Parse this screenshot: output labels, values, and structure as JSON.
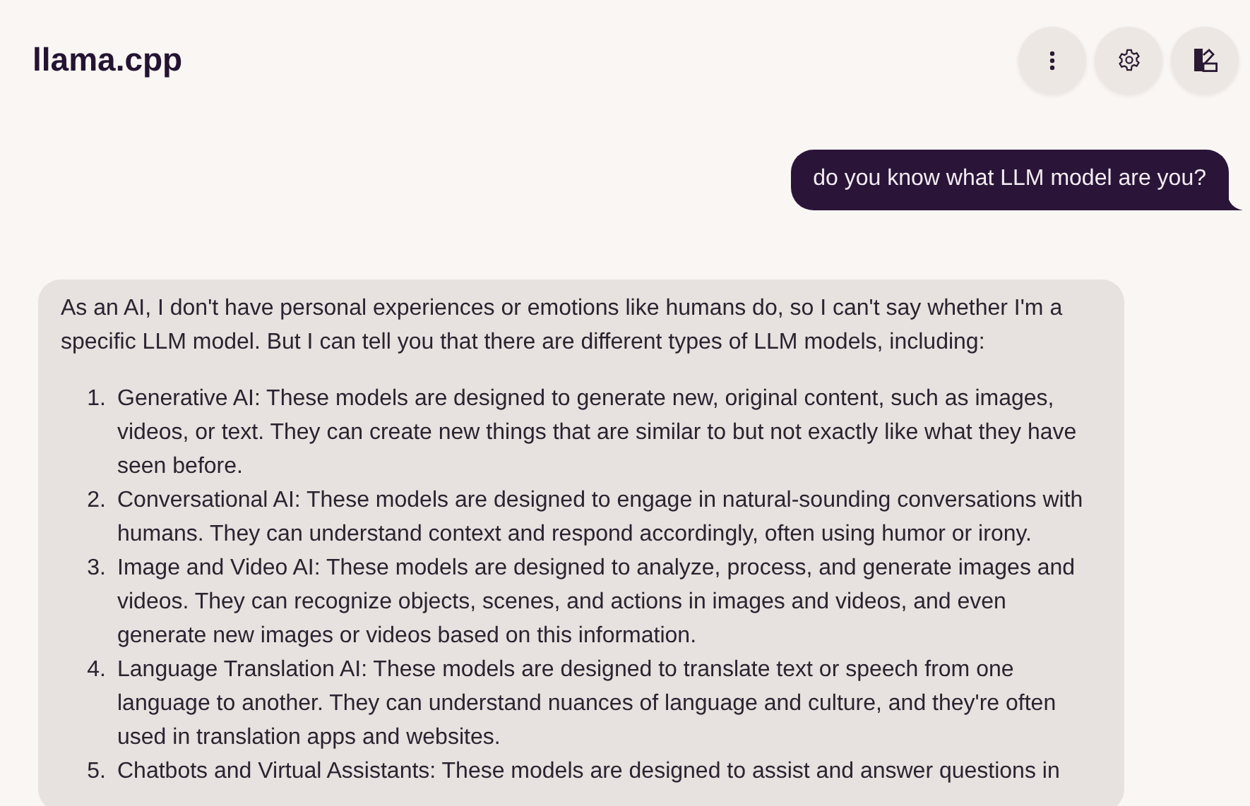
{
  "header": {
    "title": "llama.cpp",
    "buttons": [
      {
        "kind": "menu"
      },
      {
        "kind": "settings"
      },
      {
        "kind": "theme"
      }
    ]
  },
  "messages": [
    {
      "kind": "user",
      "text": "do you know what LLM model are you?"
    },
    {
      "kind": "assistant",
      "intro": "As an AI, I don't have personal experiences or emotions like humans do, so I can't say whether I'm a specific LLM model. But I can tell you that there are different types of LLM models, including:",
      "items": [
        {
          "number": "1.",
          "text": "Generative AI: These models are designed to generate new, original content, such as images, videos, or text. They can create new things that are similar to but not exactly like what they have seen before."
        },
        {
          "number": "2.",
          "text": "Conversational AI: These models are designed to engage in natural-sounding conversations with humans. They can understand context and respond accordingly, often using humor or irony."
        },
        {
          "number": "3.",
          "text": "Image and Video AI: These models are designed to analyze, process, and generate images and videos. They can recognize objects, scenes, and actions in images and videos, and even generate new images or videos based on this information."
        },
        {
          "number": "4.",
          "text": "Language Translation AI: These models are designed to translate text or speech from one language to another. They can understand nuances of language and culture, and they're often used in translation apps and websites."
        },
        {
          "number": "5.",
          "text": "Chatbots and Virtual Assistants: These models are designed to assist and answer questions in"
        }
      ]
    }
  ]
}
